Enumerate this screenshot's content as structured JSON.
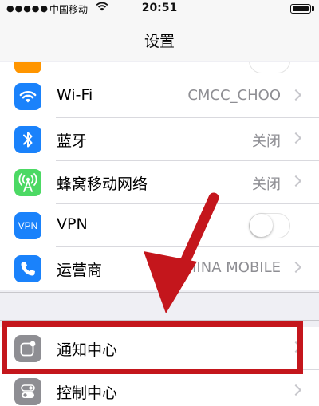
{
  "status_bar": {
    "carrier": "中国移动",
    "time": "20:51"
  },
  "nav": {
    "title": "设置"
  },
  "rows": [
    {
      "label": "Wi-Fi",
      "value": "CMCC_CHOO",
      "icon": "wifi-icon",
      "color": "#1a82fb"
    },
    {
      "label": "蓝牙",
      "value": "关闭",
      "icon": "bluetooth-icon",
      "color": "#1a82fb"
    },
    {
      "label": "蜂窝移动网络",
      "value": "关闭",
      "icon": "cellular-icon",
      "color": "#4cd964"
    },
    {
      "label": "VPN",
      "icon_text": "VPN",
      "icon": "vpn-icon",
      "color": "#1a82fb",
      "toggle_on": false
    },
    {
      "label": "运营商",
      "value": "CHINA MOBILE",
      "icon": "phone-icon",
      "color": "#1a82fb"
    }
  ],
  "rows2": [
    {
      "label": "通知中心",
      "icon": "notification-center-icon",
      "color": "#8e8e93"
    },
    {
      "label": "控制中心",
      "icon": "control-center-icon",
      "color": "#8e8e93"
    }
  ],
  "annotation": {
    "color": "#c4161c"
  }
}
